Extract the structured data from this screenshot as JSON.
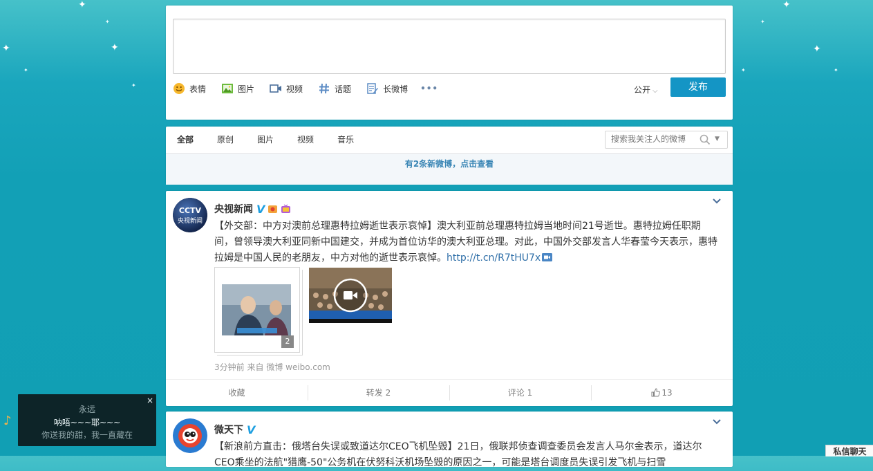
{
  "composer": {
    "tools": [
      {
        "label": "表情",
        "icon": "smiley-icon"
      },
      {
        "label": "图片",
        "icon": "image-icon"
      },
      {
        "label": "视频",
        "icon": "video-icon"
      },
      {
        "label": "话题",
        "icon": "hashtag-icon"
      },
      {
        "label": "长微博",
        "icon": "long-post-icon"
      }
    ],
    "more": "•••",
    "visibility": "公开",
    "publish_label": "发布"
  },
  "feed_tabs": {
    "items": [
      "全部",
      "原创",
      "图片",
      "视频",
      "音乐"
    ],
    "active": "全部",
    "search_placeholder": "搜索我关注人的微博",
    "new_posts": "有2条新微博，点击查看"
  },
  "posts": [
    {
      "author": "央视新闻",
      "avatar_text": "央视新闻",
      "text": "【外交部：中方对澳前总理惠特拉姆逝世表示哀悼】澳大利亚前总理惠特拉姆当地时间21号逝世。惠特拉姆任职期间，曾领导澳大利亚同新中国建交，并成为首位访华的澳大利亚总理。对此，中国外交部发言人华春莹今天表示，惠特拉姆是中国人民的老朋友，中方对他的逝世表示哀悼。",
      "link": "http://t.cn/R7tHU7x",
      "image_count": "2",
      "time": "3分钟前",
      "source_prefix": "来自",
      "source": "微博 weibo.com",
      "actions": {
        "favorite": "收藏",
        "repost": "转发 2",
        "comment": "评论 1",
        "like": "13"
      }
    },
    {
      "author": "微天下",
      "text": "【新浪前方直击：俄塔台失误或致道达尔CEO飞机坠毁】21日，俄联邦侦查调查委员会发言人马尔金表示，道达尔CEO乘坐的法航\"猎鹰-50\"公务机在伏努科沃机场坠毁的原因之一，可能是塔台调度员失误引发飞机与扫雪"
    }
  ],
  "player": {
    "title": "永远",
    "line1": "呐唔~~~耶~~~",
    "line2": "你送我的甜，我一直藏在",
    "close": "×"
  },
  "chat_label": "私信聊天",
  "colors": {
    "accent": "#1495c5",
    "background": "#12a0b6",
    "link": "#2f6fa8"
  }
}
